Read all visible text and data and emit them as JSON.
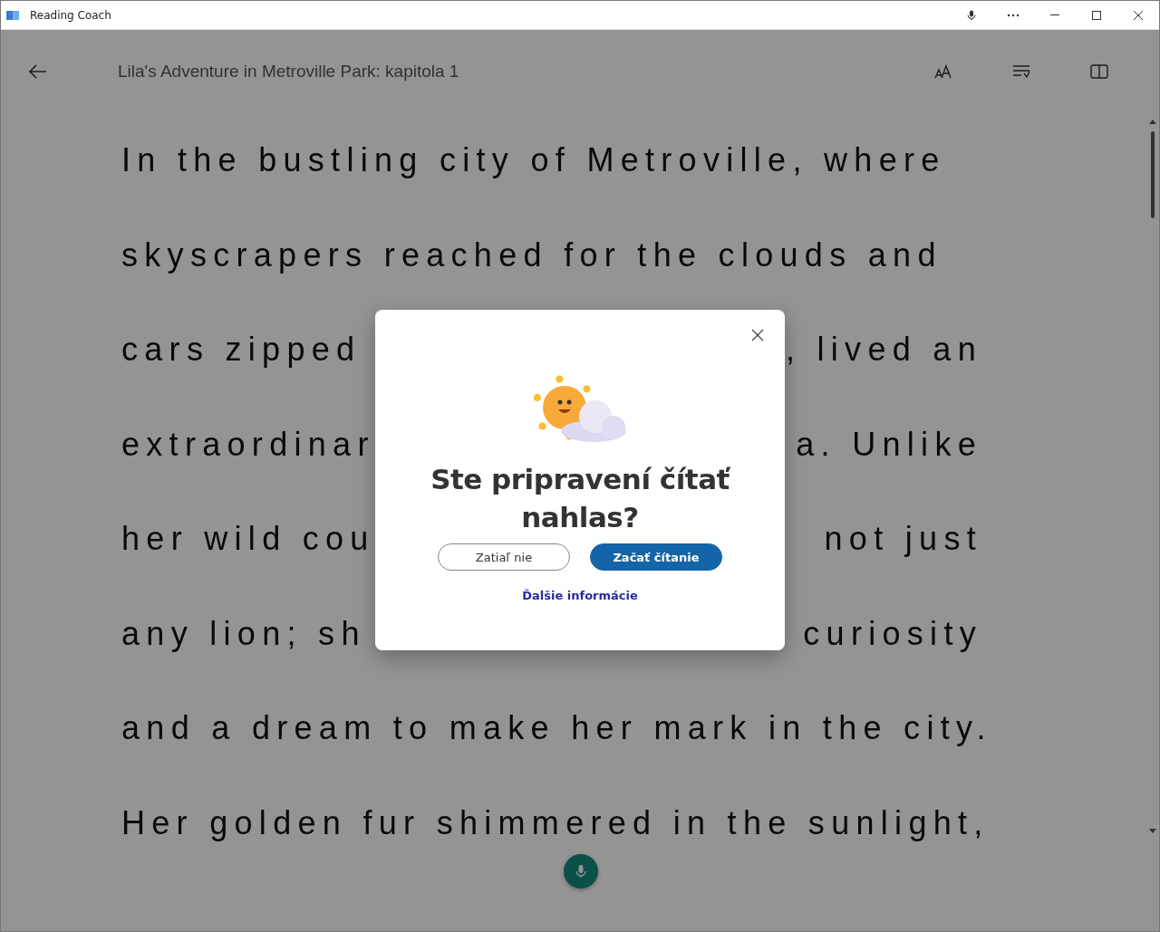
{
  "window": {
    "title": "Reading Coach"
  },
  "header": {
    "title": "Lila's Adventure in Metroville Park: kapitola 1"
  },
  "story_lines": [
    {
      "segments": [
        "In the bustling city of Metroville, where"
      ]
    },
    {
      "segments": [
        "skyscrapers reached for the clouds and"
      ]
    },
    {
      "segments": [
        "cars zipped",
        ", lived an"
      ]
    },
    {
      "segments": [
        "extraordinar",
        "a. Unlike"
      ]
    },
    {
      "segments": [
        "her wild cou",
        "not just"
      ]
    },
    {
      "segments": [
        "any lion; sh",
        "curiosity"
      ]
    },
    {
      "segments": [
        "and a dream to make her mark in the city."
      ]
    },
    {
      "segments": [
        "Her golden fur shimmered in the sunlight,"
      ]
    }
  ],
  "dialog": {
    "heading": "Ste pripravení čítať nahlas?",
    "buttons": [
      {
        "label": "Zatiaľ nie",
        "kind": "secondary"
      },
      {
        "label": "Začať čítanie",
        "kind": "primary"
      }
    ],
    "link": "Ďalšie informácie"
  }
}
